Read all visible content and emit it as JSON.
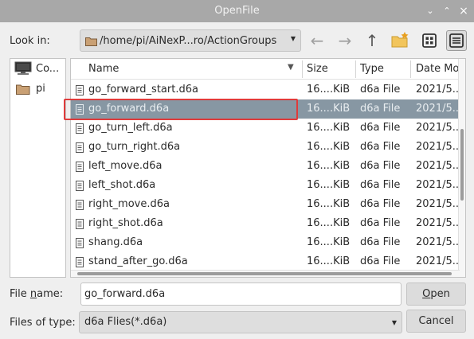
{
  "window": {
    "title": "OpenFile"
  },
  "look_in": {
    "label": "Look in:",
    "path": "/home/pi/AiNexP...ro/ActionGroups"
  },
  "sidebar": {
    "items": [
      {
        "label": "Co...",
        "icon": "computer-icon"
      },
      {
        "label": "pi",
        "icon": "folder-icon"
      }
    ]
  },
  "columns": {
    "name": "Name",
    "size": "Size",
    "type": "Type",
    "date": "Date Mo"
  },
  "files": [
    {
      "name": "go_forward_start.d6a",
      "size": "16....KiB",
      "type": "d6a File",
      "date": "2021/5..."
    },
    {
      "name": "go_forward.d6a",
      "size": "16....KiB",
      "type": "d6a File",
      "date": "2021/5..."
    },
    {
      "name": "go_turn_left.d6a",
      "size": "16....KiB",
      "type": "d6a File",
      "date": "2021/5..."
    },
    {
      "name": "go_turn_right.d6a",
      "size": "16....KiB",
      "type": "d6a File",
      "date": "2021/5..."
    },
    {
      "name": "left_move.d6a",
      "size": "16....KiB",
      "type": "d6a File",
      "date": "2021/5..."
    },
    {
      "name": "left_shot.d6a",
      "size": "16....KiB",
      "type": "d6a File",
      "date": "2021/5..."
    },
    {
      "name": "right_move.d6a",
      "size": "16....KiB",
      "type": "d6a File",
      "date": "2021/5..."
    },
    {
      "name": "right_shot.d6a",
      "size": "16....KiB",
      "type": "d6a File",
      "date": "2021/5..."
    },
    {
      "name": "shang.d6a",
      "size": "16....KiB",
      "type": "d6a File",
      "date": "2021/5..."
    },
    {
      "name": "stand_after_go.d6a",
      "size": "16....KiB",
      "type": "d6a File",
      "date": "2021/5..."
    }
  ],
  "selected_index": 1,
  "file_name": {
    "label_pre": "File ",
    "label_key": "n",
    "label_post": "ame:",
    "value": "go_forward.d6a"
  },
  "file_type": {
    "label": "Files of type:",
    "value": "d6a Flies(*.d6a)"
  },
  "buttons": {
    "open_key": "O",
    "open_rest": "pen",
    "cancel": "Cancel"
  },
  "colors": {
    "titlebar": "#a8a8a8",
    "selection": "#8797a3",
    "highlight_outline": "#e03b3b"
  }
}
